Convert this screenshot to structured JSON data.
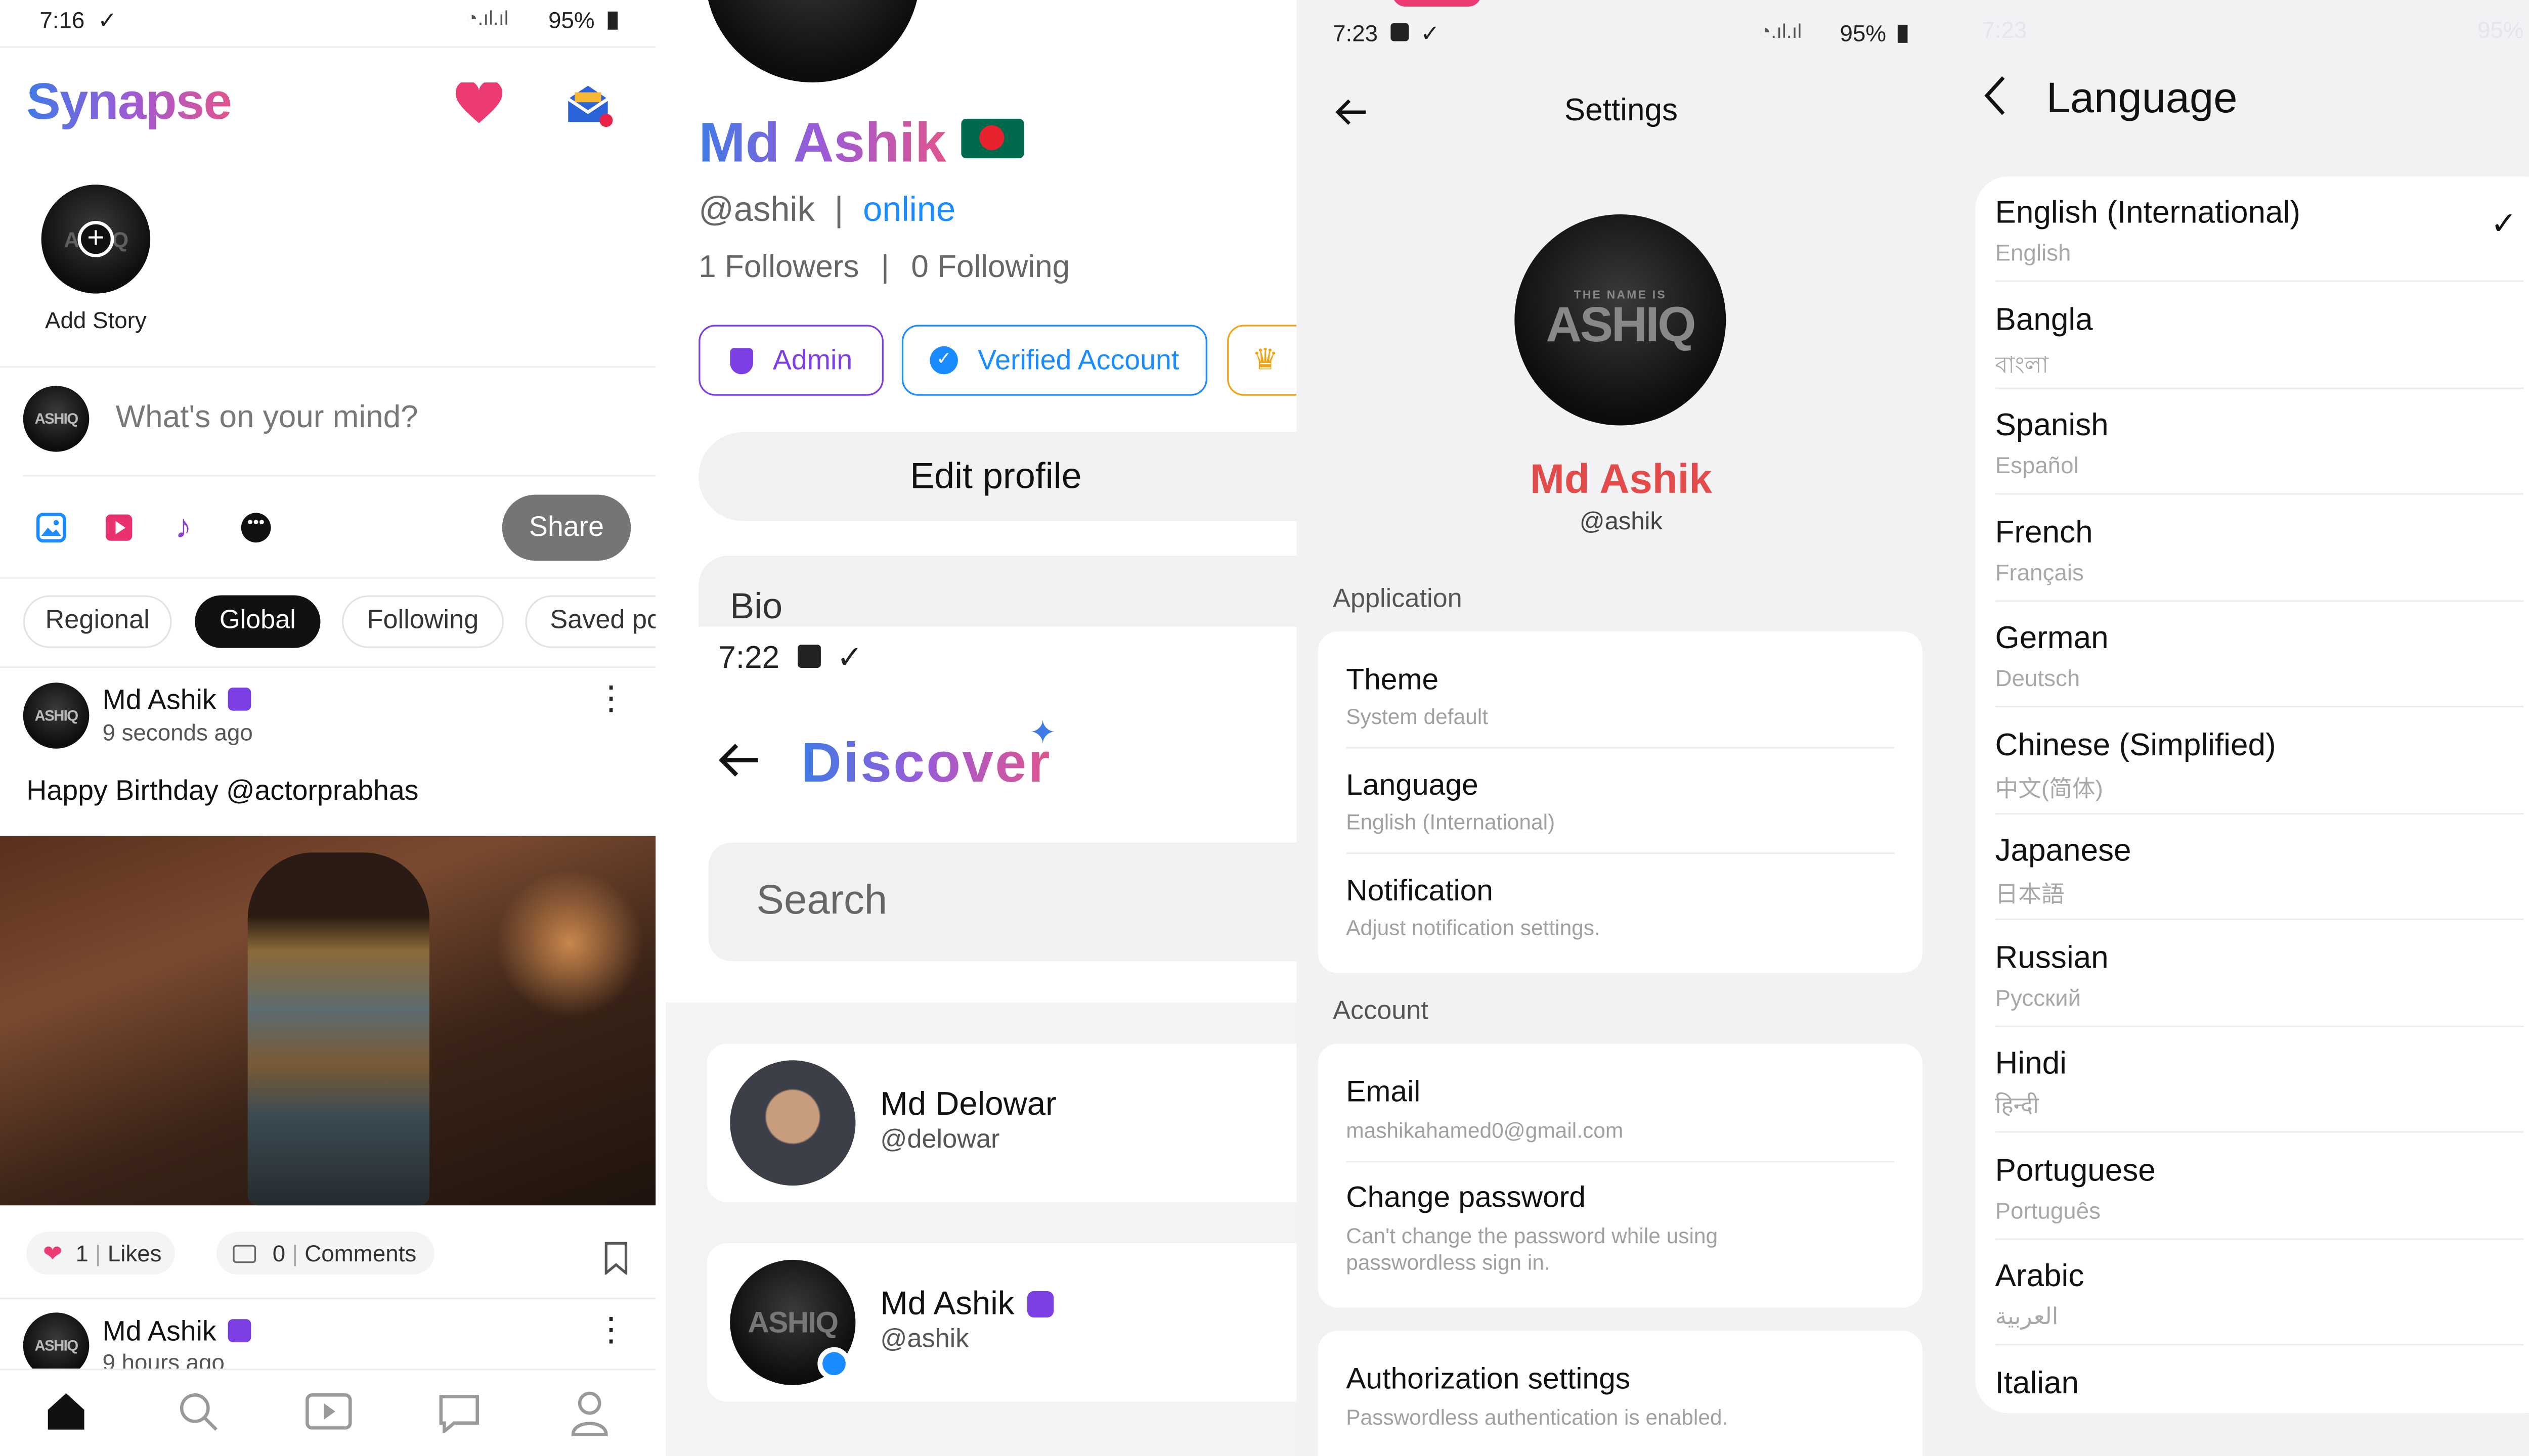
{
  "feed": {
    "status_time": "7:16",
    "status_battery": "95%",
    "app_title": "Synapse",
    "add_story": "Add Story",
    "composer_placeholder": "What's on your mind?",
    "share_label": "Share",
    "filters": [
      "Regional",
      "Global",
      "Following",
      "Saved po"
    ],
    "post1": {
      "author": "Md Ashik",
      "time": "9 seconds ago",
      "text": "Happy Birthday @actorprabhas",
      "likes": "1",
      "likes_label": "Likes",
      "comments": "0",
      "comments_label": "Comments"
    },
    "post2": {
      "author": "Md Ashik",
      "time": "9 hours ago"
    },
    "avatar_text": "ASHIQ"
  },
  "profile": {
    "name": "Md Ashik",
    "handle": "@ashik",
    "separator": "|",
    "status": "online",
    "followers": "1 Followers",
    "following": "0 Following",
    "badges": [
      "Admin",
      "Verified Account"
    ],
    "edit_profile": "Edit profile",
    "bio_label": "Bio"
  },
  "discover": {
    "status_time": "7:22",
    "title": "Discover",
    "search_placeholder": "Search",
    "users": [
      {
        "name": "Md Delowar",
        "handle": "@delowar"
      },
      {
        "name": "Md Ashik",
        "handle": "@ashik"
      }
    ]
  },
  "settings": {
    "status_time": "7:23",
    "status_battery": "95%",
    "title": "Settings",
    "name": "Md Ashik",
    "handle": "@ashik",
    "avatar_top": "THE NAME IS",
    "avatar_main": "ASHIQ",
    "application_header": "Application",
    "application_items": [
      {
        "title": "Theme",
        "subtitle": "System default"
      },
      {
        "title": "Language",
        "subtitle": "English (International)"
      },
      {
        "title": "Notification",
        "subtitle": "Adjust notification settings."
      }
    ],
    "account_header": "Account",
    "account_items": [
      {
        "title": "Email",
        "subtitle": "mashikahamed0@gmail.com"
      },
      {
        "title": "Change password",
        "subtitle": "Can't change the password while using passwordless sign in."
      }
    ],
    "auth_item": {
      "title": "Authorization settings",
      "subtitle": "Passwordless authentication is enabled."
    }
  },
  "language": {
    "status_time": "7:23",
    "status_battery": "95%",
    "title": "Language",
    "selected_check": "✓",
    "items": [
      {
        "name": "English (International)",
        "native": "English"
      },
      {
        "name": "Bangla",
        "native": "বাংলা"
      },
      {
        "name": "Spanish",
        "native": "Español"
      },
      {
        "name": "French",
        "native": "Français"
      },
      {
        "name": "German",
        "native": "Deutsch"
      },
      {
        "name": "Chinese (Simplified)",
        "native": "中文(简体)"
      },
      {
        "name": "Japanese",
        "native": "日本語"
      },
      {
        "name": "Russian",
        "native": "Русский"
      },
      {
        "name": "Hindi",
        "native": "हिन्दी"
      },
      {
        "name": "Portuguese",
        "native": "Português"
      },
      {
        "name": "Arabic",
        "native": "العربية"
      },
      {
        "name": "Italian",
        "native": ""
      }
    ]
  },
  "colors": {
    "accent_blue": "#1a8cff",
    "like_pink": "#e8316e",
    "admin_purple": "#7b3fe4",
    "name_red": "#e34b4b",
    "settings_bg": "#f2f2f5"
  }
}
